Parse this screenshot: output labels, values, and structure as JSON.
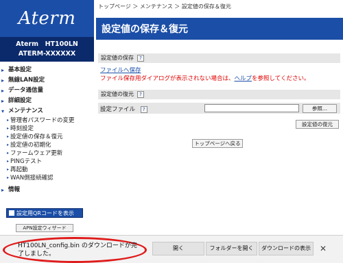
{
  "sidebar": {
    "logo": "Aterm",
    "model_line1": "Aterm　HT100LN",
    "model_line2": "ATERM-XXXXXX",
    "sections": [
      {
        "label": "基本設定"
      },
      {
        "label": "無線LAN設定"
      },
      {
        "label": "データ通信量"
      },
      {
        "label": "詳細設定"
      },
      {
        "label": "メンテナンス"
      }
    ],
    "maintenance_items": [
      "管理者パスワードの変更",
      "時刻設定",
      "設定値の保存＆復元",
      "設定値の初期化",
      "ファームウェア更新",
      "PINGテスト",
      "再起動",
      "WAN側接続確認"
    ],
    "info_label": "情報",
    "qr_button": "設定用QRコードを表示",
    "apn_button": "APN設定ウィザード"
  },
  "breadcrumb": "トップページ ＞ メンテナンス ＞ 設定値の保存＆復元",
  "page_title": "設定値の保存＆復元",
  "save_section": {
    "heading": "設定値の保存",
    "link": "ファイルへ保存",
    "warning_pre": "ファイル保存用ダイアログが表示されない場合は、",
    "warning_link": "ヘルプ",
    "warning_post": "を参照してください。"
  },
  "restore_section": {
    "heading": "設定値の復元",
    "file_label": "設定ファイル",
    "browse": "参照...",
    "restore_button": "設定値の復元"
  },
  "top_button": "トップページへ戻る",
  "download_bar": {
    "message": "HT100LN_config.bin のダウンロードが完了しました。",
    "open": "開く",
    "open_folder": "フォルダーを開く",
    "view_downloads": "ダウンロードの表示",
    "close": "✕"
  },
  "colors": {
    "brand_blue": "#1b4ea7",
    "dark_blue": "#0b2a6c",
    "warning_red": "#e00000",
    "highlight": "#e01a1a"
  }
}
